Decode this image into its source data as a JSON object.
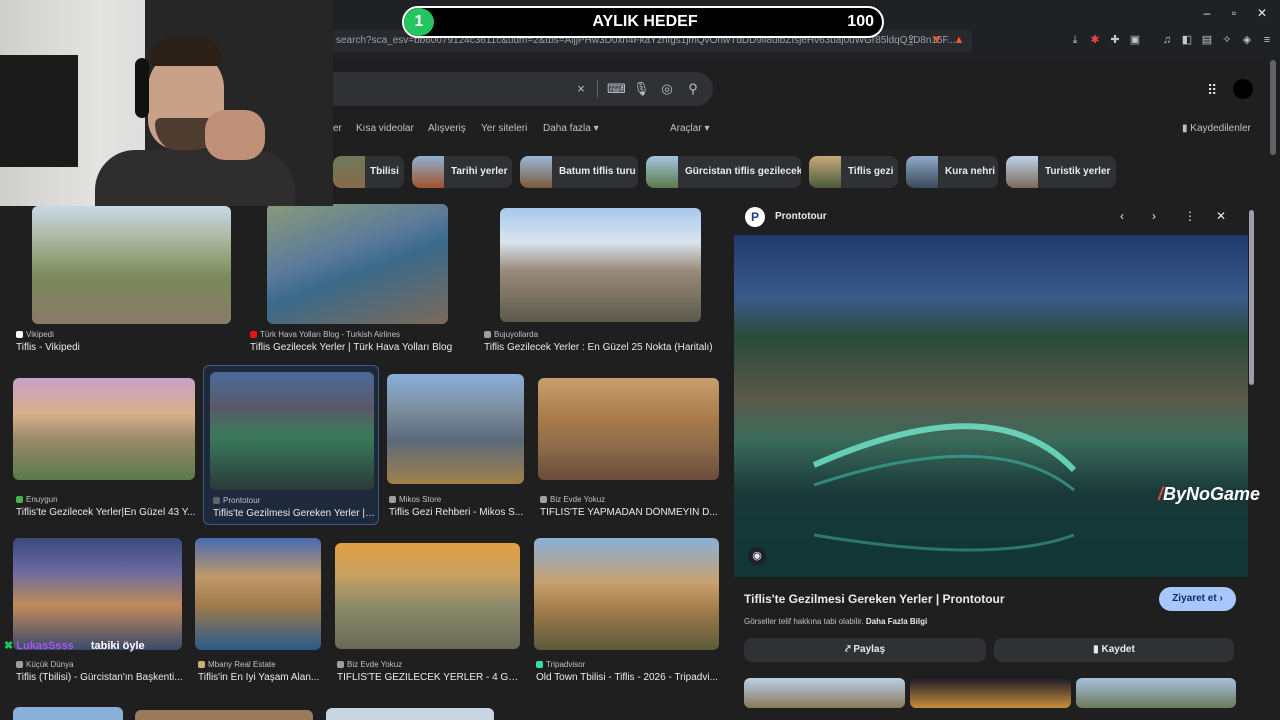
{
  "overlay": {
    "level": "1",
    "title": "AYLIK HEDEF",
    "target": "100",
    "watermark": "ByNoGame",
    "chat_user": "LukasSsss",
    "chat_text": "tabiki öyle"
  },
  "browser": {
    "url": "search?sca_esv=bb60079124c3611c&udm=2&tbs=AljjPHw3D0xn4FkaYzhfgs1jmQvOnwTdDD9ll8ulbZfsjeHv63uaj0uWGr85ldqQ_D8n15F..."
  },
  "search": {
    "clear": "×"
  },
  "nav_tabs": [
    {
      "label": "er"
    },
    {
      "label": "Kısa videolar"
    },
    {
      "label": "Alışveriş"
    },
    {
      "label": "Yer siteleri"
    },
    {
      "label": "Daha fazla"
    },
    {
      "label": "Araçlar"
    }
  ],
  "saved_label": "Kaydedilenler",
  "chips": [
    {
      "label": "Tbilisi"
    },
    {
      "label": "Tarihi yerler"
    },
    {
      "label": "Batum tiflis turu"
    },
    {
      "label": "Gürcistan tiflis gezilecek"
    },
    {
      "label": "Tiflis gezi"
    },
    {
      "label": "Kura nehri"
    },
    {
      "label": "Turistik yerler"
    }
  ],
  "results": [
    {
      "source": "Vikipedi",
      "title": "Tiflis - Vikipedi"
    },
    {
      "source": "Türk Hava Yolları Blog - Turkish Airlines",
      "title": "Tiflis Gezilecek Yerler | Türk Hava Yolları Blog"
    },
    {
      "source": "Bujuyollarda",
      "title": "Tiflis Gezilecek Yerler : En Güzel 25 Nokta (Haritalı)"
    },
    {
      "source": "Enuygun",
      "title": "Tiflis'te Gezilecek Yerler|En Güzel 43 Y..."
    },
    {
      "source": "Prontotour",
      "title": "Tiflis'te Gezilmesi Gereken Yerler | ..."
    },
    {
      "source": "Mikos Store",
      "title": "Tiflis Gezi Rehberi - Mikos S..."
    },
    {
      "source": "Biz Evde Yokuz",
      "title": "TİFLİS'TE YAPMADAN DÖNMEYİN D..."
    },
    {
      "source": "Küçük Dünya",
      "title": "Tiflis (Tbilisi) - Gürcistan'ın Başkenti..."
    },
    {
      "source": "Mbany Real Estate",
      "title": "Tiflis'in En İyi Yaşam Alan..."
    },
    {
      "source": "Biz Evde Yokuz",
      "title": "TİFLİS'TE GEZİLECEK YERLER - 4 GÜ..."
    },
    {
      "source": "Tripadvisor",
      "title": "Old Town Tbilisi - Tiflis - 2026 - Tripadvi..."
    }
  ],
  "panel": {
    "source": "Prontotour",
    "title": "Tiflis'te Gezilmesi Gereken Yerler | Prontotour",
    "visit": "Ziyaret et",
    "copyright": "Görseller telif hakkına tabi olabilir.",
    "more_info": "Daha Fazla Bilgi",
    "share": "Paylaş",
    "save": "Kaydet"
  }
}
